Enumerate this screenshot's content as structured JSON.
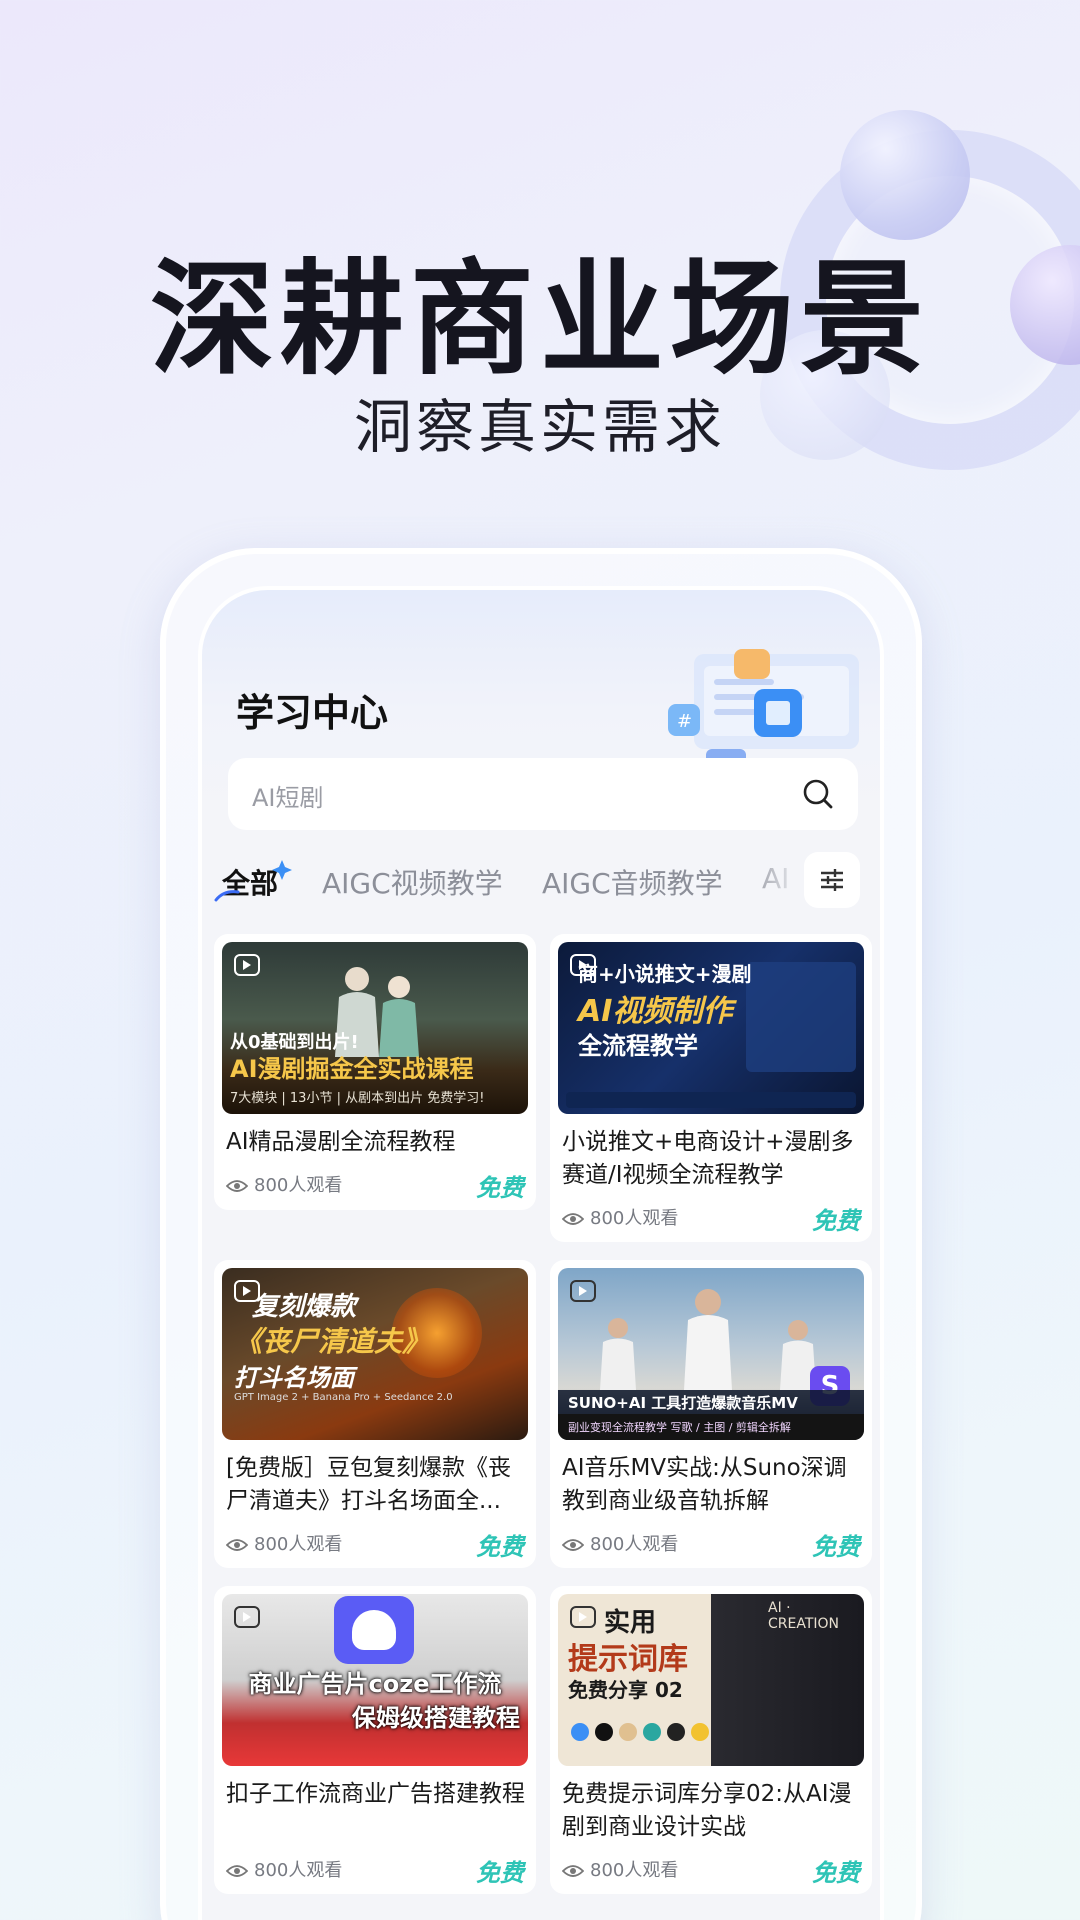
{
  "hero": {
    "title": "深耕商业场景",
    "subtitle": "洞察真实需求"
  },
  "app": {
    "page_title": "学习中心",
    "search": {
      "placeholder": "AI短剧",
      "icon": "search-icon"
    },
    "tabs": [
      {
        "label": "全部",
        "active": true
      },
      {
        "label": "AIGC视频教学",
        "active": false
      },
      {
        "label": "AIGC音频教学",
        "active": false
      },
      {
        "label": "AI",
        "active": false
      }
    ],
    "filter_icon": "sliders-icon",
    "accent_color": "#2ec4b6",
    "courses": [
      {
        "title": "AI精品漫剧全流程教程",
        "views": "800人观看",
        "price": "免费",
        "thumb_lines": [
          "从0基础到出片!",
          "AI漫剧掘金全实战课程"
        ],
        "thumb_sub": "7大模块 | 13小节 | 从剧本到出片 免费学习!"
      },
      {
        "title": "小说推文+电商设计+漫剧多赛道/I视频全流程教学",
        "views": "800人观看",
        "price": "免费",
        "thumb_lines": [
          "商+小说推文+漫剧",
          "AI视频制作",
          "全流程教学"
        ],
        "thumb_sub": ""
      },
      {
        "title": "[免费版］豆包复刻爆款《丧尸清道夫》打斗名场面全...",
        "views": "800人观看",
        "price": "免费",
        "thumb_lines": [
          "复刻爆款",
          "《丧尸清道夫》",
          "打斗名场面"
        ],
        "thumb_sub": "GPT Image 2 + Banana Pro + Seedance 2.0"
      },
      {
        "title": "AI音乐MV实战:从Suno深调教到商业级音轨拆解",
        "views": "800人观看",
        "price": "免费",
        "thumb_lines": [
          "SUNO+AI 工具打造爆款音乐MV"
        ],
        "thumb_sub": "副业变现全流程教学  写歌 / 主图 / 剪辑全拆解"
      },
      {
        "title": "扣子工作流商业广告搭建教程",
        "views": "800人观看",
        "price": "免费",
        "thumb_lines": [
          "商业广告片coze工作流",
          "保姆级搭建教程"
        ],
        "thumb_sub": ""
      },
      {
        "title": "免费提示词库分享02:从AI漫剧到商业设计实战",
        "views": "800人观看",
        "price": "免费",
        "thumb_lines": [
          "实用",
          "提示词库",
          "免费分享 02"
        ],
        "thumb_sub": "AI · CREATION"
      }
    ]
  }
}
